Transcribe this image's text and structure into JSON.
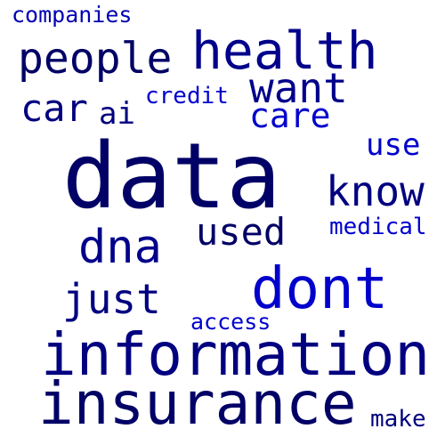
{
  "words": [
    {
      "text": "companies",
      "color": "#0000b3"
    },
    {
      "text": "health",
      "color": "#00008b"
    },
    {
      "text": "people",
      "color": "#000066"
    },
    {
      "text": "want",
      "color": "#00008b"
    },
    {
      "text": "credit",
      "color": "#0000cd"
    },
    {
      "text": "car",
      "color": "#000080"
    },
    {
      "text": "ai",
      "color": "#000080"
    },
    {
      "text": "care",
      "color": "#0000cd"
    },
    {
      "text": "use",
      "color": "#0000cd"
    },
    {
      "text": "data",
      "color": "#000066"
    },
    {
      "text": "know",
      "color": "#000080"
    },
    {
      "text": "dna",
      "color": "#00008b"
    },
    {
      "text": "used",
      "color": "#000066"
    },
    {
      "text": "medical",
      "color": "#0000cd"
    },
    {
      "text": "dont",
      "color": "#0000cd"
    },
    {
      "text": "just",
      "color": "#000080"
    },
    {
      "text": "access",
      "color": "#0000cd"
    },
    {
      "text": "information",
      "color": "#000080"
    },
    {
      "text": "insurance",
      "color": "#000066"
    },
    {
      "text": "make",
      "color": "#000080"
    }
  ]
}
